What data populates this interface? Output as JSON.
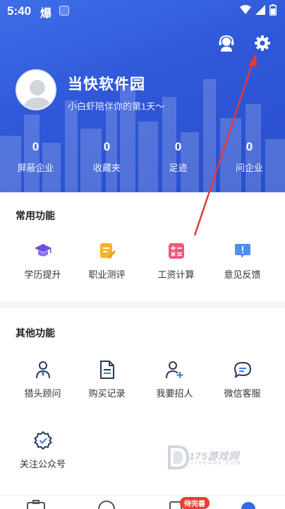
{
  "status_bar": {
    "time": "5:40",
    "app_glyph": "爆"
  },
  "profile": {
    "name": "当快软件园",
    "subtitle": "小白虾陪伴你的第1天～"
  },
  "stats": [
    {
      "value": "0",
      "label": "屏蔽企业"
    },
    {
      "value": "0",
      "label": "收藏夹"
    },
    {
      "value": "0",
      "label": "足迹"
    },
    {
      "value": "0",
      "label": "问企业"
    }
  ],
  "common_functions": {
    "title": "常用功能",
    "items": [
      {
        "label": "学历提升",
        "icon": "graduation-cap-icon"
      },
      {
        "label": "职业测评",
        "icon": "notepad-pen-icon"
      },
      {
        "label": "工资计算",
        "icon": "calculator-icon"
      },
      {
        "label": "意见反馈",
        "icon": "feedback-icon"
      }
    ]
  },
  "other_functions": {
    "title": "其他功能",
    "items": [
      {
        "label": "猎头顾问",
        "icon": "headhunter-icon"
      },
      {
        "label": "购买记录",
        "icon": "document-icon"
      },
      {
        "label": "我要招人",
        "icon": "add-person-icon"
      },
      {
        "label": "微信客服",
        "icon": "chat-bubble-icon"
      },
      {
        "label": "关注公众号",
        "icon": "verified-badge-icon"
      }
    ]
  },
  "bottom_nav": {
    "badge": "待完善"
  },
  "colors": {
    "header_blue": "#2f57d8",
    "accent_blue": "#3a7bea",
    "purple": "#6d4ee0",
    "yellow": "#f5b52a",
    "pink": "#ef5a7d",
    "blue_icon": "#4e8ef7",
    "badge_red": "#e8402f",
    "arrow_red": "#e03a3a"
  }
}
